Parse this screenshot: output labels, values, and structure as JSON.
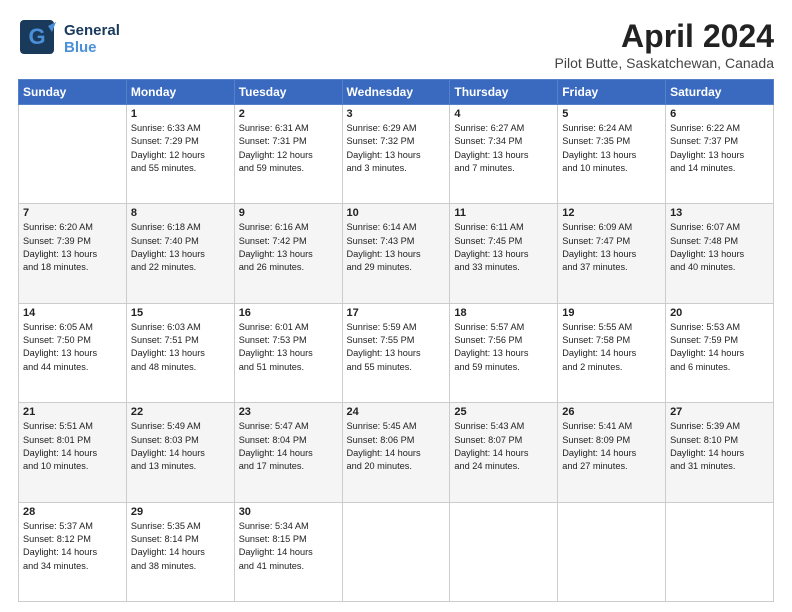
{
  "header": {
    "logo_general": "General",
    "logo_blue": "Blue",
    "title": "April 2024",
    "subtitle": "Pilot Butte, Saskatchewan, Canada"
  },
  "calendar": {
    "days_of_week": [
      "Sunday",
      "Monday",
      "Tuesday",
      "Wednesday",
      "Thursday",
      "Friday",
      "Saturday"
    ],
    "weeks": [
      [
        {
          "day": "",
          "info": ""
        },
        {
          "day": "1",
          "info": "Sunrise: 6:33 AM\nSunset: 7:29 PM\nDaylight: 12 hours\nand 55 minutes."
        },
        {
          "day": "2",
          "info": "Sunrise: 6:31 AM\nSunset: 7:31 PM\nDaylight: 12 hours\nand 59 minutes."
        },
        {
          "day": "3",
          "info": "Sunrise: 6:29 AM\nSunset: 7:32 PM\nDaylight: 13 hours\nand 3 minutes."
        },
        {
          "day": "4",
          "info": "Sunrise: 6:27 AM\nSunset: 7:34 PM\nDaylight: 13 hours\nand 7 minutes."
        },
        {
          "day": "5",
          "info": "Sunrise: 6:24 AM\nSunset: 7:35 PM\nDaylight: 13 hours\nand 10 minutes."
        },
        {
          "day": "6",
          "info": "Sunrise: 6:22 AM\nSunset: 7:37 PM\nDaylight: 13 hours\nand 14 minutes."
        }
      ],
      [
        {
          "day": "7",
          "info": "Sunrise: 6:20 AM\nSunset: 7:39 PM\nDaylight: 13 hours\nand 18 minutes."
        },
        {
          "day": "8",
          "info": "Sunrise: 6:18 AM\nSunset: 7:40 PM\nDaylight: 13 hours\nand 22 minutes."
        },
        {
          "day": "9",
          "info": "Sunrise: 6:16 AM\nSunset: 7:42 PM\nDaylight: 13 hours\nand 26 minutes."
        },
        {
          "day": "10",
          "info": "Sunrise: 6:14 AM\nSunset: 7:43 PM\nDaylight: 13 hours\nand 29 minutes."
        },
        {
          "day": "11",
          "info": "Sunrise: 6:11 AM\nSunset: 7:45 PM\nDaylight: 13 hours\nand 33 minutes."
        },
        {
          "day": "12",
          "info": "Sunrise: 6:09 AM\nSunset: 7:47 PM\nDaylight: 13 hours\nand 37 minutes."
        },
        {
          "day": "13",
          "info": "Sunrise: 6:07 AM\nSunset: 7:48 PM\nDaylight: 13 hours\nand 40 minutes."
        }
      ],
      [
        {
          "day": "14",
          "info": "Sunrise: 6:05 AM\nSunset: 7:50 PM\nDaylight: 13 hours\nand 44 minutes."
        },
        {
          "day": "15",
          "info": "Sunrise: 6:03 AM\nSunset: 7:51 PM\nDaylight: 13 hours\nand 48 minutes."
        },
        {
          "day": "16",
          "info": "Sunrise: 6:01 AM\nSunset: 7:53 PM\nDaylight: 13 hours\nand 51 minutes."
        },
        {
          "day": "17",
          "info": "Sunrise: 5:59 AM\nSunset: 7:55 PM\nDaylight: 13 hours\nand 55 minutes."
        },
        {
          "day": "18",
          "info": "Sunrise: 5:57 AM\nSunset: 7:56 PM\nDaylight: 13 hours\nand 59 minutes."
        },
        {
          "day": "19",
          "info": "Sunrise: 5:55 AM\nSunset: 7:58 PM\nDaylight: 14 hours\nand 2 minutes."
        },
        {
          "day": "20",
          "info": "Sunrise: 5:53 AM\nSunset: 7:59 PM\nDaylight: 14 hours\nand 6 minutes."
        }
      ],
      [
        {
          "day": "21",
          "info": "Sunrise: 5:51 AM\nSunset: 8:01 PM\nDaylight: 14 hours\nand 10 minutes."
        },
        {
          "day": "22",
          "info": "Sunrise: 5:49 AM\nSunset: 8:03 PM\nDaylight: 14 hours\nand 13 minutes."
        },
        {
          "day": "23",
          "info": "Sunrise: 5:47 AM\nSunset: 8:04 PM\nDaylight: 14 hours\nand 17 minutes."
        },
        {
          "day": "24",
          "info": "Sunrise: 5:45 AM\nSunset: 8:06 PM\nDaylight: 14 hours\nand 20 minutes."
        },
        {
          "day": "25",
          "info": "Sunrise: 5:43 AM\nSunset: 8:07 PM\nDaylight: 14 hours\nand 24 minutes."
        },
        {
          "day": "26",
          "info": "Sunrise: 5:41 AM\nSunset: 8:09 PM\nDaylight: 14 hours\nand 27 minutes."
        },
        {
          "day": "27",
          "info": "Sunrise: 5:39 AM\nSunset: 8:10 PM\nDaylight: 14 hours\nand 31 minutes."
        }
      ],
      [
        {
          "day": "28",
          "info": "Sunrise: 5:37 AM\nSunset: 8:12 PM\nDaylight: 14 hours\nand 34 minutes."
        },
        {
          "day": "29",
          "info": "Sunrise: 5:35 AM\nSunset: 8:14 PM\nDaylight: 14 hours\nand 38 minutes."
        },
        {
          "day": "30",
          "info": "Sunrise: 5:34 AM\nSunset: 8:15 PM\nDaylight: 14 hours\nand 41 minutes."
        },
        {
          "day": "",
          "info": ""
        },
        {
          "day": "",
          "info": ""
        },
        {
          "day": "",
          "info": ""
        },
        {
          "day": "",
          "info": ""
        }
      ]
    ]
  }
}
